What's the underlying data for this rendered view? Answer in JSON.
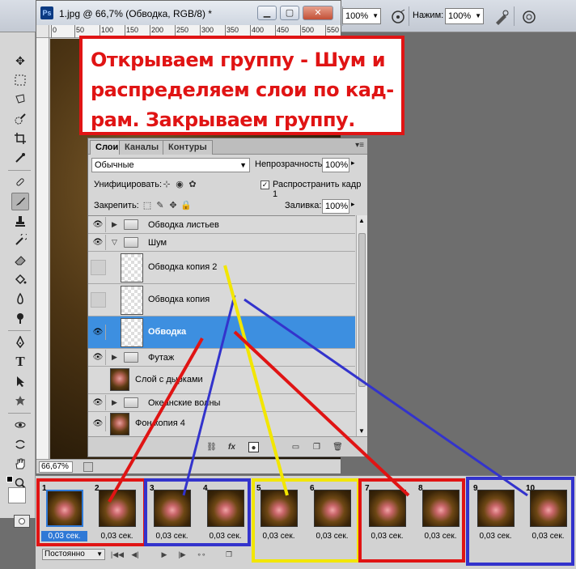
{
  "options_bar": {
    "opacity_value": "100%",
    "pressure_label": "Нажим:",
    "pressure_value": "100%"
  },
  "document": {
    "title": "1.jpg @ 66,7% (Обводка, RGB/8) *",
    "app_icon": "Ps",
    "zoom": "66,67%",
    "ruler_marks": [
      "0",
      "50",
      "100",
      "150",
      "200",
      "250",
      "300",
      "350",
      "400",
      "450",
      "500",
      "550"
    ]
  },
  "annotation": {
    "text": "Открываем группу - Шум и распределяем слои по кад-рам. Закрываем группу."
  },
  "layers_panel": {
    "tabs": [
      "Слои",
      "Каналы",
      "Контуры"
    ],
    "blend_mode": "Обычные",
    "opacity_label": "Непрозрачность:",
    "opacity_value": "100%",
    "unify_label": "Унифицировать:",
    "propagate_label": "Распространить кадр 1",
    "lock_label": "Закрепить:",
    "fill_label": "Заливка:",
    "fill_value": "100%",
    "layers": [
      {
        "name": "Обводка листьев",
        "type": "group",
        "visible": true
      },
      {
        "name": "Шум",
        "type": "group-open",
        "visible": true
      },
      {
        "name": "Обводка копия 2",
        "type": "layer",
        "visible": false
      },
      {
        "name": "Обводка копия",
        "type": "layer",
        "visible": false
      },
      {
        "name": "Обводка",
        "type": "layer",
        "visible": true,
        "selected": true
      },
      {
        "name": "Футаж",
        "type": "group",
        "visible": true
      },
      {
        "name": "Слой с дырками",
        "type": "photo",
        "visible": false
      },
      {
        "name": "Океанские волны",
        "type": "group",
        "visible": true
      },
      {
        "name": "Фон копия 4",
        "type": "photo",
        "visible": true
      }
    ],
    "bottom_icons": [
      "link-icon",
      "fx-icon",
      "mask-icon",
      "adjustment-icon",
      "folder-icon",
      "new-layer-icon",
      "trash-icon"
    ],
    "fx_label": "fx"
  },
  "animation_panel": {
    "frames": [
      {
        "num": "1",
        "delay": "0,03 сек.",
        "selected": true
      },
      {
        "num": "2",
        "delay": "0,03 сек."
      },
      {
        "num": "3",
        "delay": "0,03 сек."
      },
      {
        "num": "4",
        "delay": "0,03 сек."
      },
      {
        "num": "5",
        "delay": "0,03 сек."
      },
      {
        "num": "6",
        "delay": "0,03 сек."
      },
      {
        "num": "7",
        "delay": "0,03 сек."
      },
      {
        "num": "8",
        "delay": "0,03 сек."
      },
      {
        "num": "9",
        "delay": "0,03 сек."
      },
      {
        "num": "10",
        "delay": "0,03 сек."
      }
    ],
    "loop_value": "Постоянно"
  },
  "colors": {
    "highlight_red": "#e01414",
    "highlight_blue": "#3333cc",
    "highlight_yellow": "#f2e600",
    "selection_blue": "#3d8fe0"
  }
}
